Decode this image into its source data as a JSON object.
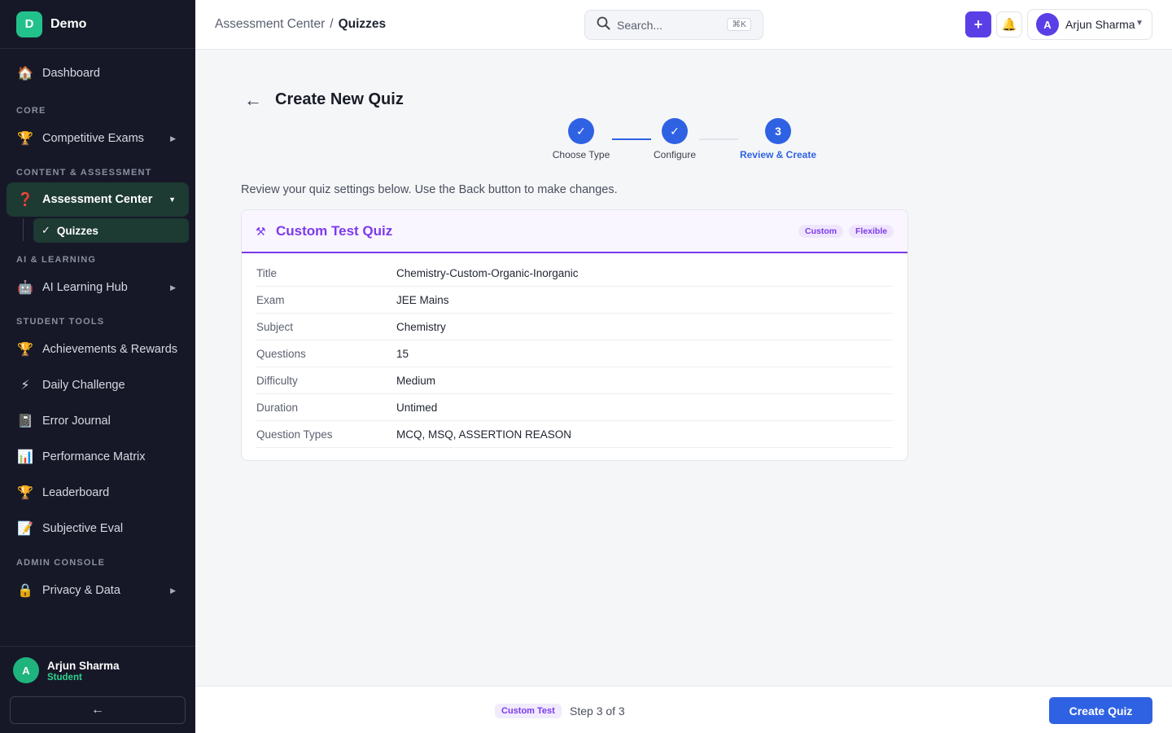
{
  "brand": {
    "logo": "D",
    "name": "Demo"
  },
  "sidebar": {
    "dashboard": {
      "label": "Dashboard",
      "icon": "🏠"
    },
    "sections": {
      "core": "CORE",
      "content": "CONTENT & ASSESSMENT",
      "ai": "AI & LEARNING",
      "student": "STUDENT TOOLS",
      "admin": "ADMIN CONSOLE"
    },
    "competitive_exams": {
      "label": "Competitive Exams",
      "icon": "🏆"
    },
    "assessment_center": {
      "label": "Assessment Center",
      "icon": "❓"
    },
    "quizzes": {
      "label": "Quizzes",
      "check": "✓"
    },
    "ai_hub": {
      "label": "AI Learning Hub",
      "icon": "🤖"
    },
    "achievements": {
      "label": "Achievements & Rewards",
      "icon": "🏆"
    },
    "daily_challenge": {
      "label": "Daily Challenge",
      "icon": "⚡"
    },
    "error_journal": {
      "label": "Error Journal",
      "icon": "📓"
    },
    "performance": {
      "label": "Performance Matrix",
      "icon": "📊"
    },
    "leaderboard": {
      "label": "Leaderboard",
      "icon": "🏆"
    },
    "subjective": {
      "label": "Subjective Eval",
      "icon": "📝"
    },
    "privacy": {
      "label": "Privacy & Data",
      "icon": "🔒"
    },
    "user": {
      "initial": "A",
      "name": "Arjun Sharma",
      "role": "Student"
    },
    "collapse_icon": "←"
  },
  "header": {
    "breadcrumb_parent": "Assessment Center",
    "breadcrumb_sep": "/",
    "breadcrumb_current": "Quizzes",
    "search_placeholder": "Search...",
    "search_shortcut": "⌘K",
    "add_icon": "+",
    "bell_icon": "🔔",
    "profile_initial": "A",
    "profile_name": "Arjun Sharma",
    "profile_caret": "▼"
  },
  "page": {
    "back_icon": "←",
    "title": "Create New Quiz",
    "intro": "Review your quiz settings below. Use the Back button to make changes."
  },
  "steps": [
    {
      "label": "Choose Type",
      "mark": "✓",
      "state": "done"
    },
    {
      "label": "Configure",
      "mark": "✓",
      "state": "done"
    },
    {
      "label": "Review & Create",
      "mark": "3",
      "state": "current"
    }
  ],
  "card": {
    "icon": "⚒",
    "title": "Custom Test Quiz",
    "tags": [
      "Custom",
      "Flexible"
    ],
    "rows": [
      {
        "label": "Title",
        "value": "Chemistry-Custom-Organic-Inorganic"
      },
      {
        "label": "Exam",
        "value": "JEE Mains"
      },
      {
        "label": "Subject",
        "value": "Chemistry"
      },
      {
        "label": "Questions",
        "value": "15"
      },
      {
        "label": "Difficulty",
        "value": "Medium"
      },
      {
        "label": "Duration",
        "value": "Untimed"
      },
      {
        "label": "Question Types",
        "value": "MCQ, MSQ, ASSERTION REASON"
      }
    ]
  },
  "footer": {
    "tag": "Custom Test",
    "step_text": "Step 3 of 3",
    "create_label": "Create Quiz"
  },
  "colors": {
    "primary": "#2f62e3",
    "accent_purple": "#7c3aed",
    "brand_green": "#22c08a",
    "sidebar_bg": "#161827"
  }
}
